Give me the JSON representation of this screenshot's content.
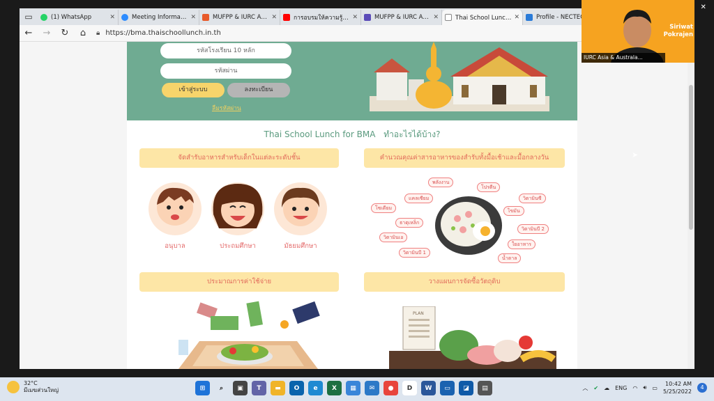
{
  "tabs": [
    {
      "title": "(1) WhatsApp",
      "color": "#25d366"
    },
    {
      "title": "Meeting Information",
      "color": "#2d8cff"
    },
    {
      "title": "MUFPP & IURC Asia F",
      "color": "#e85a2a"
    },
    {
      "title": "การอบรมให้ความรู้เกี่ยวกั",
      "color": "#ff0000"
    },
    {
      "title": "MUFPP & IURC Asia F",
      "color": "#5b4bb8"
    },
    {
      "title": "Thai School Lunch สำห",
      "color": "#ffffff"
    },
    {
      "title": "Profile - NECTEC : N",
      "color": "#2a7bd8"
    }
  ],
  "address": {
    "url": "https://bma.thaischoollunch.in.th"
  },
  "hero": {
    "school_code_placeholder": "รหัสโรงเรียน 10 หลัก",
    "password_placeholder": "รหัสผ่าน",
    "login_label": "เข้าสู่ระบบ",
    "register_label": "ลงทะเบียน",
    "forgot_label": "ลืมรหัสผ่าน"
  },
  "headline": {
    "en": "Thai School Lunch for BMA",
    "th": "ทำอะไรได้บ้าง?"
  },
  "sections": {
    "meal_title": "จัดสำรับอาหารสำหรับเด็กในแต่ละระดับชั้น",
    "nutrient_title": "คำนวณคุณค่าสารอาหารของสำรับทั้งมื้อเช้าและมื้อกลางวัน",
    "cost_title": "ประมาณการค่าใช้จ่าย",
    "plan_title": "วางแผนการจัดซื้อวัตถุดิบ"
  },
  "kids": [
    "อนุบาล",
    "ประถมศึกษา",
    "มัธยมศึกษา"
  ],
  "nutrients": [
    "พลังงาน",
    "โปรตีน",
    "แคลเซียม",
    "วิตามินซี",
    "โซเดียม",
    "ไขมัน",
    "ธาตุเหล็ก",
    "วิตามินบี 2",
    "วิตามินเอ",
    "ใยอาหาร",
    "วิตามินบี 1",
    "น้ำตาล"
  ],
  "plan_sheet": "PLAN",
  "video": {
    "label": "IURC Asia & Australa...",
    "speaker": "Siriwat Pokrajen"
  },
  "taskbar": {
    "temp": "32°C",
    "weather_text": "มีเมฆส่วนใหญ่",
    "lang": "ENG",
    "time": "10:42 AM",
    "date": "5/25/2022",
    "notif_count": "4"
  }
}
